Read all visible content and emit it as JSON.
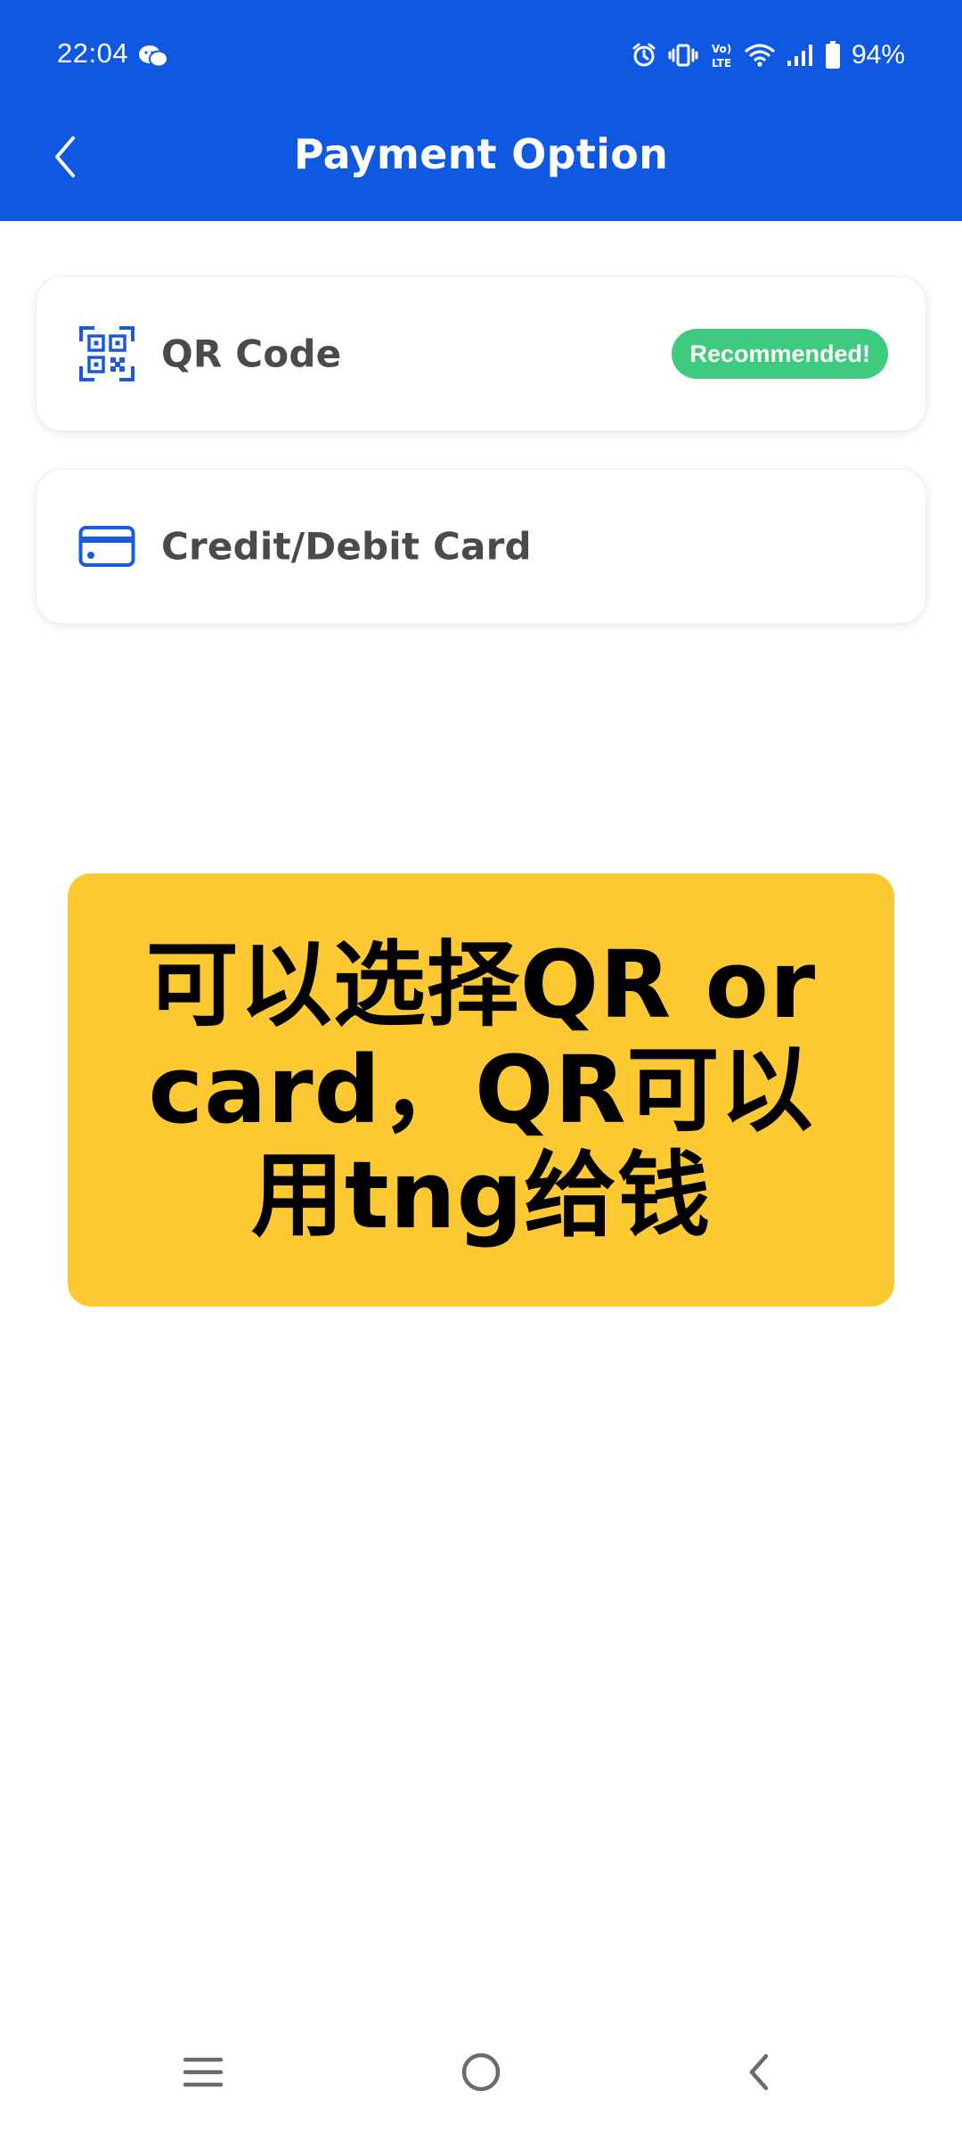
{
  "status_bar": {
    "time": "22:04",
    "battery": "94%",
    "lte_label_top": "Vo)",
    "lte_label_bottom": "LTE"
  },
  "header": {
    "title": "Payment Option",
    "background_color": "#0f58e2"
  },
  "options": [
    {
      "label": "QR Code",
      "icon": "qr-code-icon",
      "badge": "Recommended!"
    },
    {
      "label": "Credit/Debit Card",
      "icon": "credit-card-icon"
    }
  ],
  "caption": {
    "text": "可以选择QR  or card，QR可以用tng给钱",
    "background_color": "#fdc933"
  },
  "colors": {
    "accent": "#1a5bd8",
    "badge": "#3fcb7f",
    "label": "#4a4a4a"
  }
}
